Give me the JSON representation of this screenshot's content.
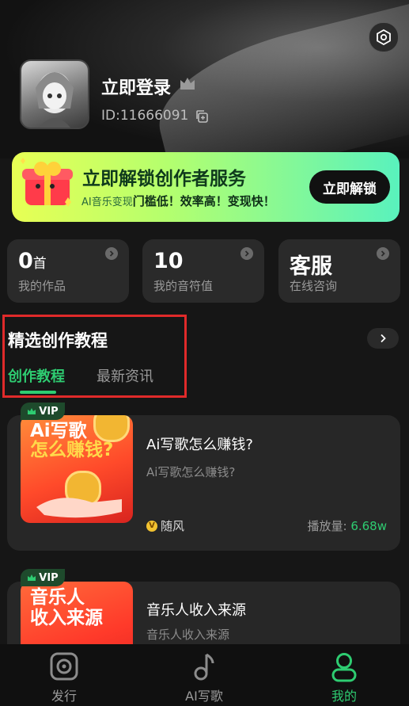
{
  "profile": {
    "login_title": "立即登录",
    "user_id": "ID:11666091"
  },
  "banner": {
    "title": "立即解锁创作者服务",
    "sub_prefix": "AI音乐变现",
    "sub_highlight": "门槛低！效率高！变现快！",
    "button": "立即解锁"
  },
  "stats": [
    {
      "value": "0",
      "unit": "首",
      "label": "我的作品"
    },
    {
      "value": "10",
      "unit": "",
      "label": "我的音符值"
    },
    {
      "value": "客服",
      "unit": "",
      "label": "在线咨询"
    }
  ],
  "section": {
    "title": "精选创作教程",
    "tabs": [
      "创作教程",
      "最新资讯"
    ]
  },
  "cards": [
    {
      "vip": "VIP",
      "thumb_line1": "Ai写歌",
      "thumb_line2": "怎么赚钱?",
      "title": "Ai写歌怎么赚钱?",
      "subtitle": "Ai写歌怎么赚钱?",
      "author": "随风",
      "plays_label": "播放量: ",
      "plays_value": "6.68w"
    },
    {
      "vip": "VIP",
      "thumb_line1": "音乐人",
      "thumb_line2": "收入来源",
      "title": "音乐人收入来源",
      "subtitle": "音乐人收入来源"
    }
  ],
  "nav": [
    {
      "label": "发行",
      "icon": "release-icon"
    },
    {
      "label": "AI写歌",
      "icon": "music-note-icon"
    },
    {
      "label": "我的",
      "icon": "profile-icon"
    }
  ],
  "colors": {
    "accent": "#2ecc71",
    "background": "#161616",
    "card": "#272727",
    "highlight_box": "#e02a2a"
  }
}
